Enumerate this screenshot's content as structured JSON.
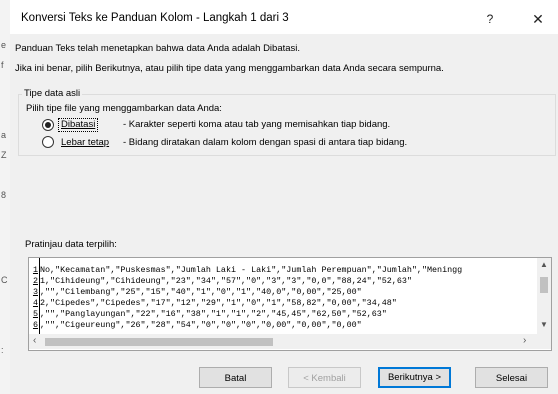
{
  "window": {
    "title": "Konversi Teks ke Panduan Kolom - Langkah 1 dari 3",
    "help_label": "?",
    "close_label": "✕"
  },
  "intro": {
    "line1": "Panduan Teks telah menetapkan bahwa data Anda adalah Dibatasi.",
    "line2": "Jika ini benar, pilih Berikutnya, atau pilih tipe data yang menggambarkan data Anda secara sempurna."
  },
  "original_type": {
    "group_label": "Tipe data asli",
    "prompt": "Pilih tipe file yang menggambarkan data Anda:",
    "options": [
      {
        "label": "Dibatasi",
        "description": "- Karakter seperti koma atau tab yang memisahkan tiap bidang.",
        "selected": true
      },
      {
        "label": "Lebar tetap",
        "description": "- Bidang diratakan dalam kolom dengan spasi di antara tiap bidang.",
        "selected": false
      }
    ]
  },
  "preview": {
    "label": "Pratinjau data terpilih:",
    "rows": [
      {
        "n": "1",
        "text": "No,\"Kecamatan\",\"Puskesmas\",\"Jumlah Laki - Laki\",\"Jumlah Perempuan\",\"Jumlah\",\"Meningg"
      },
      {
        "n": "2",
        "text": "1,\"Cihideung\",\"Cihideung\",\"23\",\"34\",\"57\",\"0\",\"3\",\"3\",\"0,0\",\"88,24\",\"52,63\""
      },
      {
        "n": "3",
        "text": ",\"\",\"Cilembang\",\"25\",\"15\",\"40\",\"1\",\"0\",\"1\",\"40,0\",\"0,00\",\"25,00\""
      },
      {
        "n": "4",
        "text": "2,\"Cipedes\",\"Cipedes\",\"17\",\"12\",\"29\",\"1\",\"0\",\"1\",\"58,82\",\"0,00\",\"34,48\""
      },
      {
        "n": "5",
        "text": ",\"\",\"Panglayungan\",\"22\",\"16\",\"38\",\"1\",\"1\",\"2\",\"45,45\",\"62,50\",\"52,63\""
      },
      {
        "n": "6",
        "text": ",\"\",\"Cigeureung\",\"26\",\"28\",\"54\",\"0\",\"0\",\"0\",\"0,00\",\"0,00\",\"0,00\""
      }
    ]
  },
  "buttons": {
    "cancel": "Batal",
    "back": "< Kembali",
    "next": "Berikutnya >",
    "finish": "Selesai"
  },
  "background_margin": [
    "e",
    "f",
    "a",
    "Z",
    "8",
    "C",
    ":"
  ]
}
